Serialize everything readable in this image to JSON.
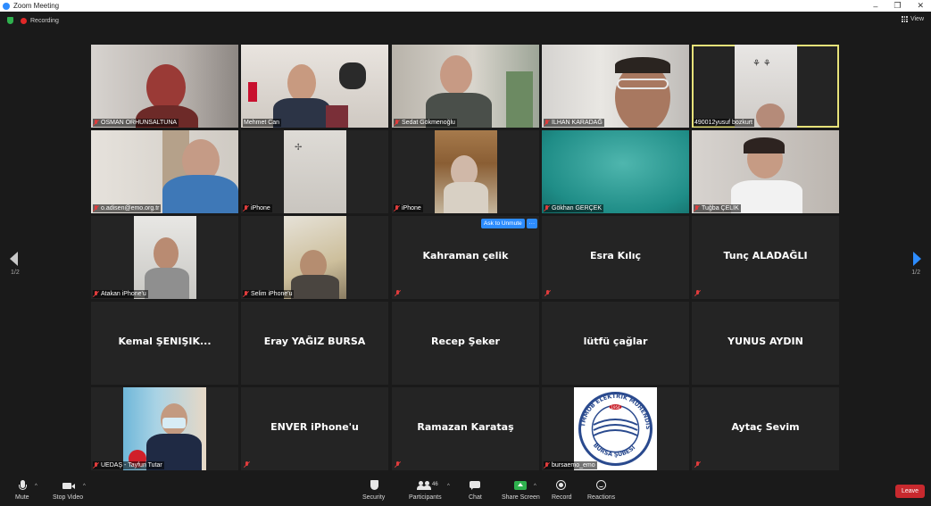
{
  "window": {
    "title": "Zoom Meeting",
    "controls": [
      "–",
      "❐",
      "✕"
    ]
  },
  "status": {
    "recording_label": "Recording",
    "view_label": "View"
  },
  "pagination": {
    "left": "1/2",
    "right": "1/2"
  },
  "popup": {
    "ask_unmute": "Ask to Unmute",
    "more": "···"
  },
  "tiles": [
    {
      "name": "OSMAN ORHUNSALTUNA",
      "kind": "video"
    },
    {
      "name": "Mehmet Can",
      "kind": "video"
    },
    {
      "name": "Sedat Gökmenoğlu",
      "kind": "video"
    },
    {
      "name": "İLHAN KARADAĞ",
      "kind": "video"
    },
    {
      "name": "490012yusuf bozkurt",
      "kind": "video",
      "active": true
    },
    {
      "name": "o.adisen@emo.org.tr",
      "kind": "video"
    },
    {
      "name": "iPhone",
      "kind": "video"
    },
    {
      "name": "iPhone",
      "kind": "video"
    },
    {
      "name": "Gökhan GERÇEK",
      "kind": "video"
    },
    {
      "name": "Tuğba ÇELİK",
      "kind": "video"
    },
    {
      "name": "Atakan iPhone'u",
      "kind": "video"
    },
    {
      "name": "Selim iPhone'u",
      "kind": "video"
    },
    {
      "name": "Kahraman çelik",
      "kind": "text"
    },
    {
      "name": "Esra Kılıç",
      "kind": "text"
    },
    {
      "name": "Tunç ALADAĞLI",
      "kind": "text"
    },
    {
      "name": "Kemal  ŞENIŞIK...",
      "kind": "text"
    },
    {
      "name": "Eray YAĞIZ BURSA",
      "kind": "text"
    },
    {
      "name": "Recep Şeker",
      "kind": "text"
    },
    {
      "name": "lütfü çağlar",
      "kind": "text"
    },
    {
      "name": "YUNUS AYDIN",
      "kind": "text"
    },
    {
      "name": "UEDAŞ - Tayfun Tutar",
      "kind": "video"
    },
    {
      "name": "ENVER iPhone'u",
      "kind": "text"
    },
    {
      "name": "Ramazan Karataş",
      "kind": "text"
    },
    {
      "name": "bursaemo_emo",
      "kind": "video"
    },
    {
      "name": "Aytaç Sevim",
      "kind": "text"
    }
  ],
  "logo": {
    "ring_text": "TMMOB ELEKTRİK MÜHENDİSLERİ ODASI",
    "bottom_text": "BURSA ŞUBESİ",
    "year": "1954"
  },
  "toolbar": {
    "mute": "Mute",
    "stop_video": "Stop Video",
    "security": "Security",
    "participants": "Participants",
    "participants_count": "46",
    "chat": "Chat",
    "share_screen": "Share Screen",
    "record": "Record",
    "reactions": "Reactions",
    "leave": "Leave"
  },
  "colors": {
    "accent": "#2d8cff",
    "active_border": "#e7e27a",
    "leave": "#c8292e",
    "share": "#2fb14e",
    "muted_red": "#e03c3c"
  }
}
